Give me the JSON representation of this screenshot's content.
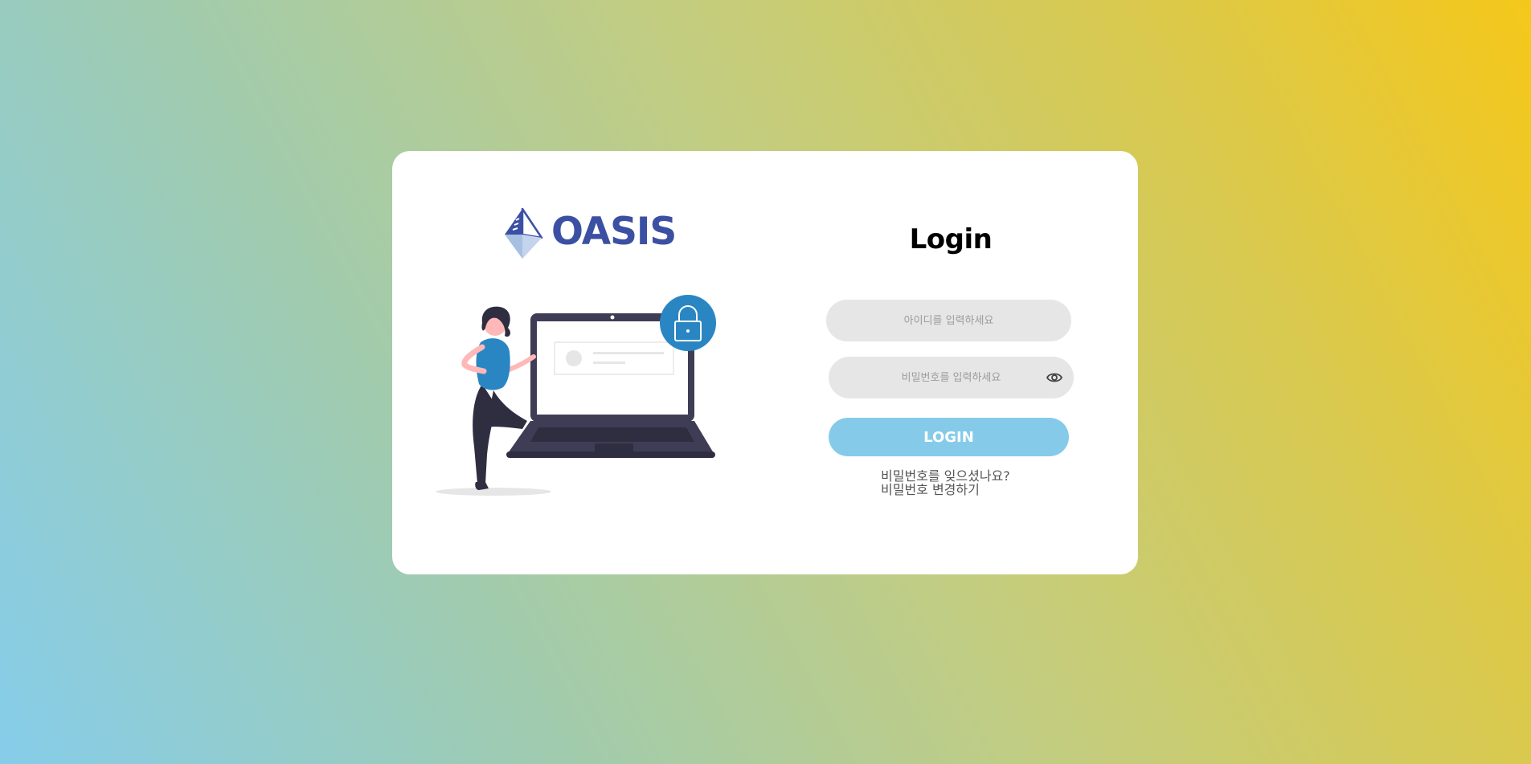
{
  "brand": {
    "name": "OASIS",
    "color": "#3c50a3"
  },
  "login": {
    "title": "Login",
    "id_placeholder": "아이디를 입력하세요",
    "password_placeholder": "비밀번호를 입력하세요",
    "submit_label": "LOGIN",
    "forgot_password": "비밀번호를 잊으셨나요?",
    "change_password": "비밀번호 변경하기",
    "button_color": "#85cbe9",
    "field_color": "#e6e6e6"
  },
  "icons": {
    "logo": "diamond-logo-icon",
    "password_toggle": "eye-icon",
    "lock": "lock-icon"
  }
}
